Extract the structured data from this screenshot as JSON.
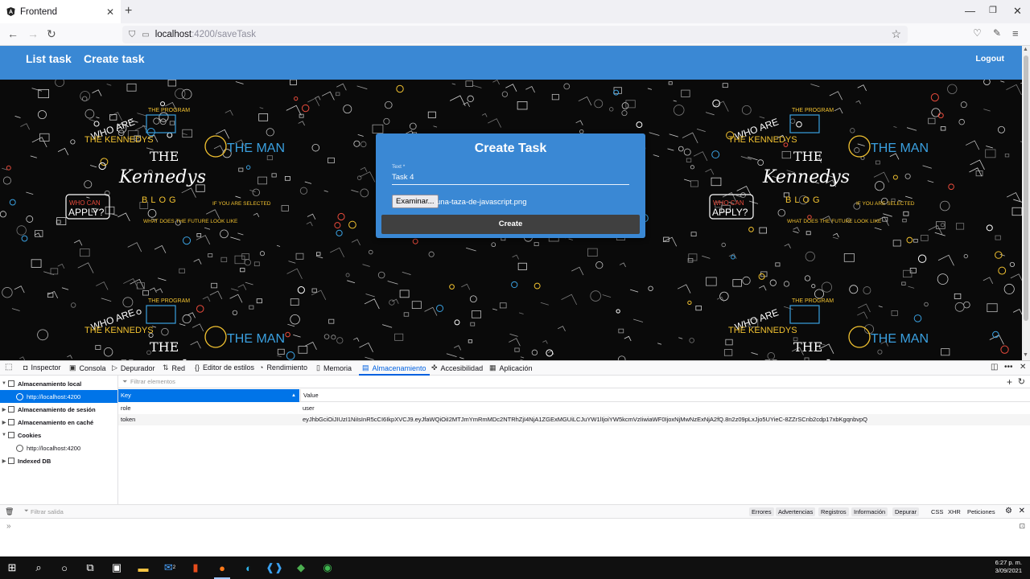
{
  "browser": {
    "tab_title": "Frontend",
    "url_host": "localhost",
    "url_path": ":4200/saveTask"
  },
  "app": {
    "nav": [
      {
        "label": "List task"
      },
      {
        "label": "Create task"
      }
    ],
    "logout_label": "Logout",
    "banner_texts": {
      "who_are": "WHO ARE",
      "the_kennedys": "THE KENNEDYS",
      "the_program": "THE PROGRAM",
      "the": "THE",
      "kennedys_script": "Kennedys",
      "blog": "BLOG",
      "who_can": "WHO CAN",
      "apply": "APPLY?",
      "if_you_are": "IF YOU ARE SELECTED",
      "what_does": "WHAT DOES THE FUTURE LOOK LIKE",
      "the_man": "THE MAN"
    },
    "form": {
      "title": "Create Task",
      "text_label": "Text *",
      "text_value": "Task 4",
      "file_button": "Examinar...",
      "file_name": "una-taza-de-javascript.png",
      "submit_label": "Create"
    }
  },
  "devtools": {
    "tabs": [
      {
        "label": "Inspector",
        "icon": "inspector-icon"
      },
      {
        "label": "Consola",
        "icon": "console-icon"
      },
      {
        "label": "Depurador",
        "icon": "debugger-icon"
      },
      {
        "label": "Red",
        "icon": "network-icon"
      },
      {
        "label": "Editor de estilos",
        "icon": "style-editor-icon"
      },
      {
        "label": "Rendimiento",
        "icon": "performance-icon"
      },
      {
        "label": "Memoria",
        "icon": "memory-icon"
      },
      {
        "label": "Almacenamiento",
        "icon": "storage-icon"
      },
      {
        "label": "Accesibilidad",
        "icon": "accessibility-icon"
      },
      {
        "label": "Aplicación",
        "icon": "application-icon"
      }
    ],
    "active_tab": "Almacenamiento",
    "tree": [
      {
        "label": "Almacenamiento local",
        "bold": true
      },
      {
        "label": "http://localhost:4200",
        "selected": true
      },
      {
        "label": "Almacenamiento de sesión",
        "bold": true
      },
      {
        "label": "Almacenamiento en caché",
        "bold": true
      },
      {
        "label": "Cookies",
        "bold": true
      },
      {
        "label": "http://localhost:4200"
      },
      {
        "label": "Indexed DB",
        "bold": true
      }
    ],
    "filter_placeholder": "Filtrar elementos",
    "table": {
      "columns": [
        "Key",
        "Value"
      ],
      "rows": [
        {
          "key": "role",
          "value": "user"
        },
        {
          "key": "token",
          "value": "eyJhbGciOiJIUzI1NiIsInR5cCI6IkpXVCJ9.eyJfaWQiOiI2MTJmYmRmMDc2NTRhZjI4NjA1ZGExMGUiLCJuYW1lIjoiYW5kcmVzIiwiaWF0IjoxNjMwNzExNjA2fQ.8n2z09pLxJjo5UYieC-8ZZrSCnb2cdp17xbKgqnbvpQ"
        }
      ]
    },
    "console": {
      "filter_placeholder": "Filtrar salida",
      "levels": [
        "Errores",
        "Advertencias",
        "Registros",
        "Información",
        "Depurar"
      ],
      "types": [
        "CSS",
        "XHR",
        "Peticiones"
      ]
    }
  },
  "taskbar": {
    "time": "6:27 p. m.",
    "date": "3/09/2021",
    "badge": "2"
  },
  "colors": {
    "header": "#3a88d4",
    "card": "#3a88d4",
    "button": "#404040",
    "selection": "#0074e8"
  }
}
